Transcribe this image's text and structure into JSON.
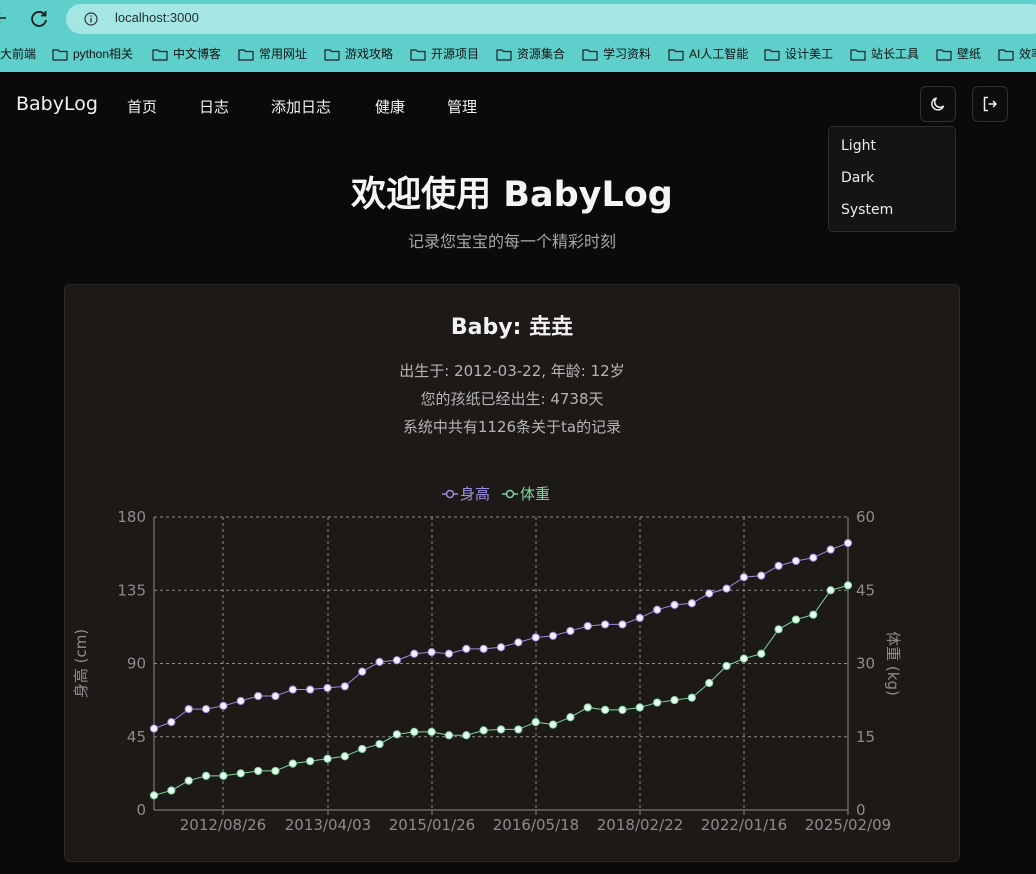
{
  "browser": {
    "url": "localhost:3000",
    "bookmarks": [
      "大前端",
      "python相关",
      "中文博客",
      "常用网址",
      "游戏攻略",
      "开源项目",
      "资源集合",
      "学习资料",
      "AI人工智能",
      "设计美工",
      "站长工具",
      "壁纸",
      "效率"
    ]
  },
  "nav": {
    "brand": "BabyLog",
    "links": [
      "首页",
      "日志",
      "添加日志",
      "健康",
      "管理"
    ]
  },
  "theme_menu": [
    "Light",
    "Dark",
    "System"
  ],
  "hero": {
    "title": "欢迎使用 BabyLog",
    "subtitle": "记录您宝宝的每一个精彩时刻"
  },
  "baby": {
    "name": "Baby: 垚垚",
    "born": "出生于: 2012-03-22, 年龄: 12岁",
    "days": "您的孩纸已经出生: 4738天",
    "records": "系统中共有1126条关于ta的记录"
  },
  "colors": {
    "height_series": "#9b8fe0",
    "weight_series": "#7fd6a0"
  },
  "chart_data": {
    "type": "line",
    "xlabel": "",
    "ylabel": "身高 (cm)",
    "y2label": "体重 (kg)",
    "ylim": [
      0,
      180
    ],
    "y2lim": [
      0,
      60
    ],
    "yticks": [
      0,
      45,
      90,
      135,
      180
    ],
    "y2ticks": [
      0,
      15,
      30,
      45,
      60
    ],
    "xticks": [
      "2012/08/26",
      "2013/04/03",
      "2015/01/26",
      "2016/05/18",
      "2018/02/22",
      "2022/01/16",
      "2025/02/09"
    ],
    "grid": true,
    "legend": "top-center",
    "series": [
      {
        "name": "身高",
        "axis": "left",
        "values": [
          50,
          54,
          62,
          62,
          64,
          67,
          70,
          70,
          74,
          74,
          75,
          76,
          85,
          91,
          92,
          96,
          97,
          96,
          99,
          99,
          100,
          103,
          106,
          107,
          110,
          113,
          114,
          114,
          118,
          123,
          126,
          127,
          133,
          136,
          143,
          144,
          150,
          153,
          155,
          160,
          164
        ]
      },
      {
        "name": "体重",
        "axis": "right",
        "values": [
          3,
          4,
          6,
          7,
          7,
          7.5,
          8,
          8,
          9.5,
          10,
          10.5,
          11,
          12.5,
          13.5,
          15.5,
          16,
          16,
          15.3,
          15.3,
          16.3,
          16.5,
          16.5,
          18,
          17.5,
          19,
          21,
          20.5,
          20.5,
          21,
          22,
          22.5,
          23,
          26,
          29.5,
          31,
          32,
          37,
          39,
          40,
          45,
          46
        ]
      }
    ]
  }
}
